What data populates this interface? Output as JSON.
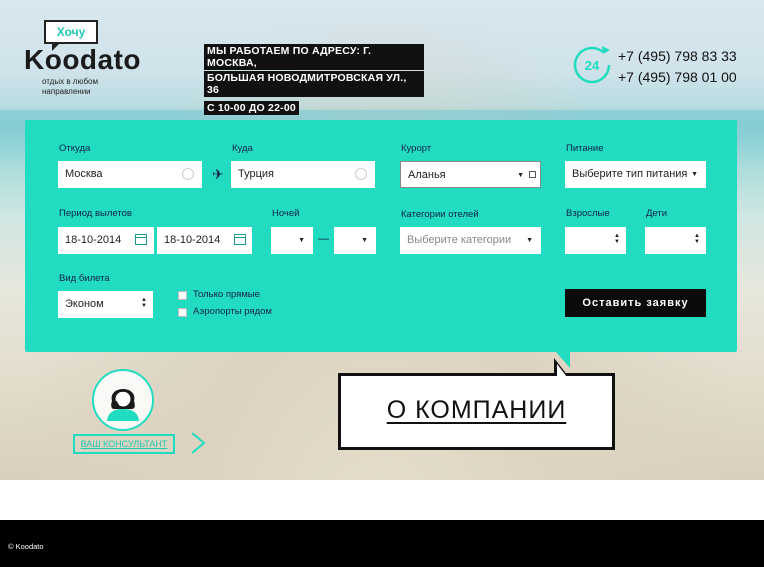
{
  "header": {
    "logo_bubble": "Хочу",
    "logo_name": "Koodato",
    "logo_tagline": "отдых в любом направлении",
    "address_lines": [
      "МЫ РАБОТАЕМ ПО АДРЕСУ: Г. МОСКВА,",
      "БОЛЬШАЯ НОВОДМИТРОВСКАЯ УЛ., 36",
      "С 10-00 ДО 22-00"
    ],
    "phone_icon_label": "24",
    "phones": [
      "+7 (495) 798 83 33",
      "+7 (495) 798 01 00"
    ]
  },
  "form": {
    "from": {
      "label": "Откуда",
      "value": "Москва"
    },
    "to": {
      "label": "Куда",
      "value": "Турция"
    },
    "resort": {
      "label": "Курорт",
      "value": "Аланья"
    },
    "meals": {
      "label": "Питание",
      "value": "Выберите тип питания"
    },
    "departure": {
      "label": "Период вылетов",
      "from": "18-10-2014",
      "to": "18-10-2014"
    },
    "nights": {
      "label": "Ночей",
      "separator": "—"
    },
    "hotel_categories": {
      "label": "Категории отелей",
      "placeholder": "Выберите категории"
    },
    "adults": {
      "label": "Взрослые"
    },
    "children": {
      "label": "Дети"
    },
    "ticket": {
      "label": "Вид билета",
      "value": "Эконом"
    },
    "direct_only": "Только прямые",
    "nearby_airports": "Аэропорты рядом",
    "submit": "Оставить заявку"
  },
  "consultant": {
    "label": "ВАШ КОНСУЛЬТАНТ"
  },
  "about": {
    "label": "О КОМПАНИИ"
  },
  "footer": {
    "copyright": "© Koodato"
  },
  "colors": {
    "accent": "#21dcc0",
    "dark": "#0b0b0b"
  }
}
